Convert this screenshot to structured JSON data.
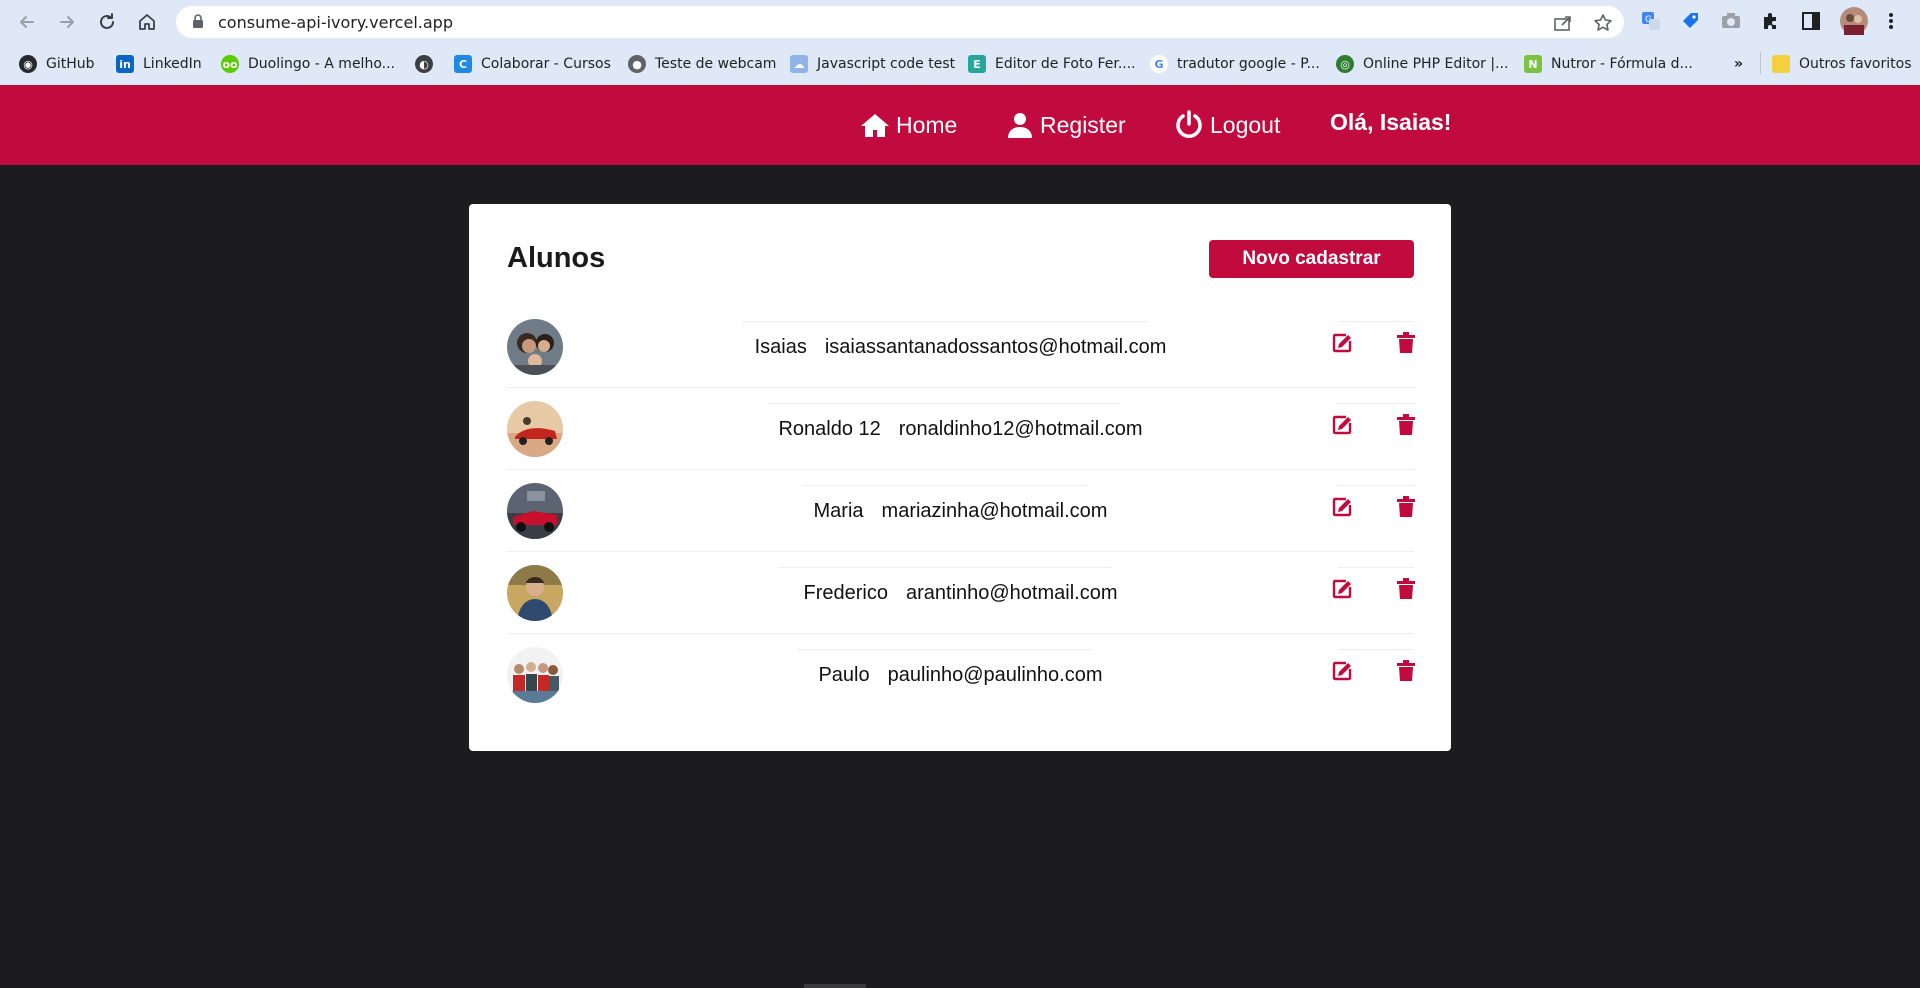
{
  "browser": {
    "url": "consume-api-ivory.vercel.app",
    "bookmarks": [
      {
        "label": "GitHub",
        "icon": "github-icon"
      },
      {
        "label": "LinkedIn",
        "icon": "linkedin-icon"
      },
      {
        "label": "Duolingo - A melho...",
        "icon": "duolingo-icon"
      },
      {
        "label": "",
        "icon": "globe-icon"
      },
      {
        "label": "Colaborar - Cursos",
        "icon": "colaborar-icon"
      },
      {
        "label": "Teste de webcam",
        "icon": "webcam-icon"
      },
      {
        "label": "Javascript code test",
        "icon": "cloud-icon"
      },
      {
        "label": "Editor de Foto Fer....",
        "icon": "photo-editor-icon"
      },
      {
        "label": "tradutor google - P...",
        "icon": "google-icon"
      },
      {
        "label": "Online PHP Editor |...",
        "icon": "php-editor-icon"
      },
      {
        "label": "Nutror - Fórmula d...",
        "icon": "nutror-icon"
      }
    ],
    "overflow_label": "»",
    "other_favorites": "Outros favoritos"
  },
  "header": {
    "home": "Home",
    "register": "Register",
    "logout": "Logout",
    "greeting": "Olá, Isaias!"
  },
  "main": {
    "title": "Alunos",
    "new_button": "Novo cadastrar",
    "students": [
      {
        "name": "Isaias",
        "email": "isaiassantanadossantos@hotmail.com"
      },
      {
        "name": "Ronaldo 12",
        "email": "ronaldinho12@hotmail.com"
      },
      {
        "name": "Maria",
        "email": "mariazinha@hotmail.com"
      },
      {
        "name": "Frederico",
        "email": "arantinho@hotmail.com"
      },
      {
        "name": "Paulo",
        "email": "paulinho@paulinho.com"
      }
    ]
  },
  "colors": {
    "brand": "#c10a3e",
    "background": "#1c1b1e",
    "card": "#ffffff"
  }
}
